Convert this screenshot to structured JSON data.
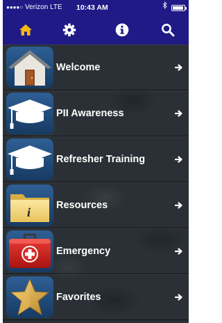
{
  "status_bar": {
    "signal_dots": "●●●●○",
    "carrier": "Verizon",
    "network": "LTE",
    "time": "10:43 AM",
    "battery_level": 0.95
  },
  "nav": {
    "bg_color": "#1f1a86",
    "active_color": "#f6b813",
    "buttons": [
      {
        "icon": "home-icon",
        "active": true
      },
      {
        "icon": "gear-icon",
        "active": false
      },
      {
        "icon": "info-icon",
        "active": false
      },
      {
        "icon": "search-icon",
        "active": false
      }
    ]
  },
  "menu": {
    "items": [
      {
        "label": "Welcome",
        "icon": "house-icon"
      },
      {
        "label": "PII Awareness",
        "icon": "graduation-cap-icon"
      },
      {
        "label": "Refresher Training",
        "icon": "graduation-cap-icon"
      },
      {
        "label": "Resources",
        "icon": "info-folder-icon"
      },
      {
        "label": "Emergency",
        "icon": "first-aid-kit-icon"
      },
      {
        "label": "Favorites",
        "icon": "star-icon"
      }
    ]
  }
}
